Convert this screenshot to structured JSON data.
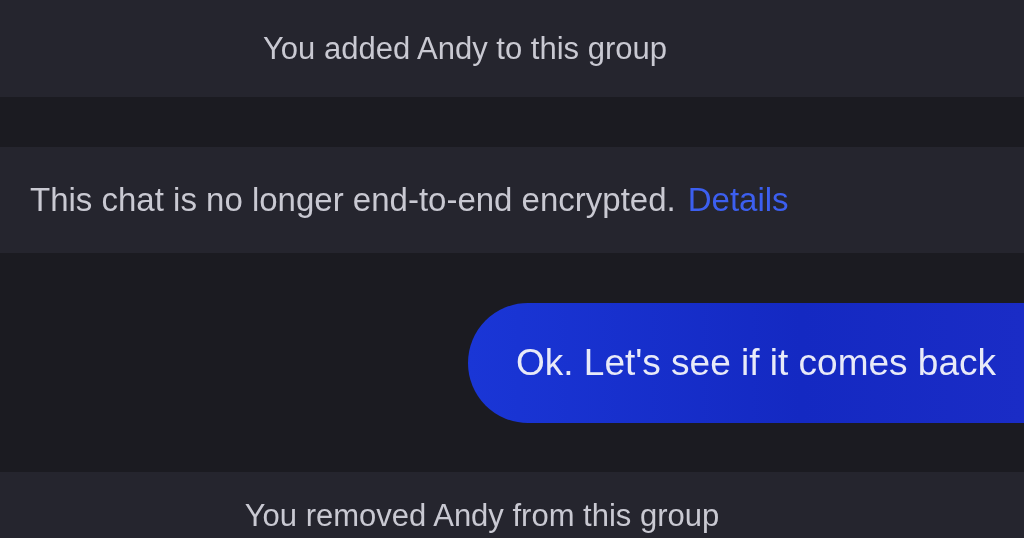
{
  "messages": [
    {
      "kind": "system",
      "text": "You added Andy to this group"
    },
    {
      "kind": "notice",
      "text": "This chat is no longer end-to-end encrypted.",
      "link": "Details"
    },
    {
      "kind": "outgoing",
      "text": "Ok. Let's see if it comes back"
    },
    {
      "kind": "system",
      "text": "You removed Andy from this group"
    }
  ]
}
